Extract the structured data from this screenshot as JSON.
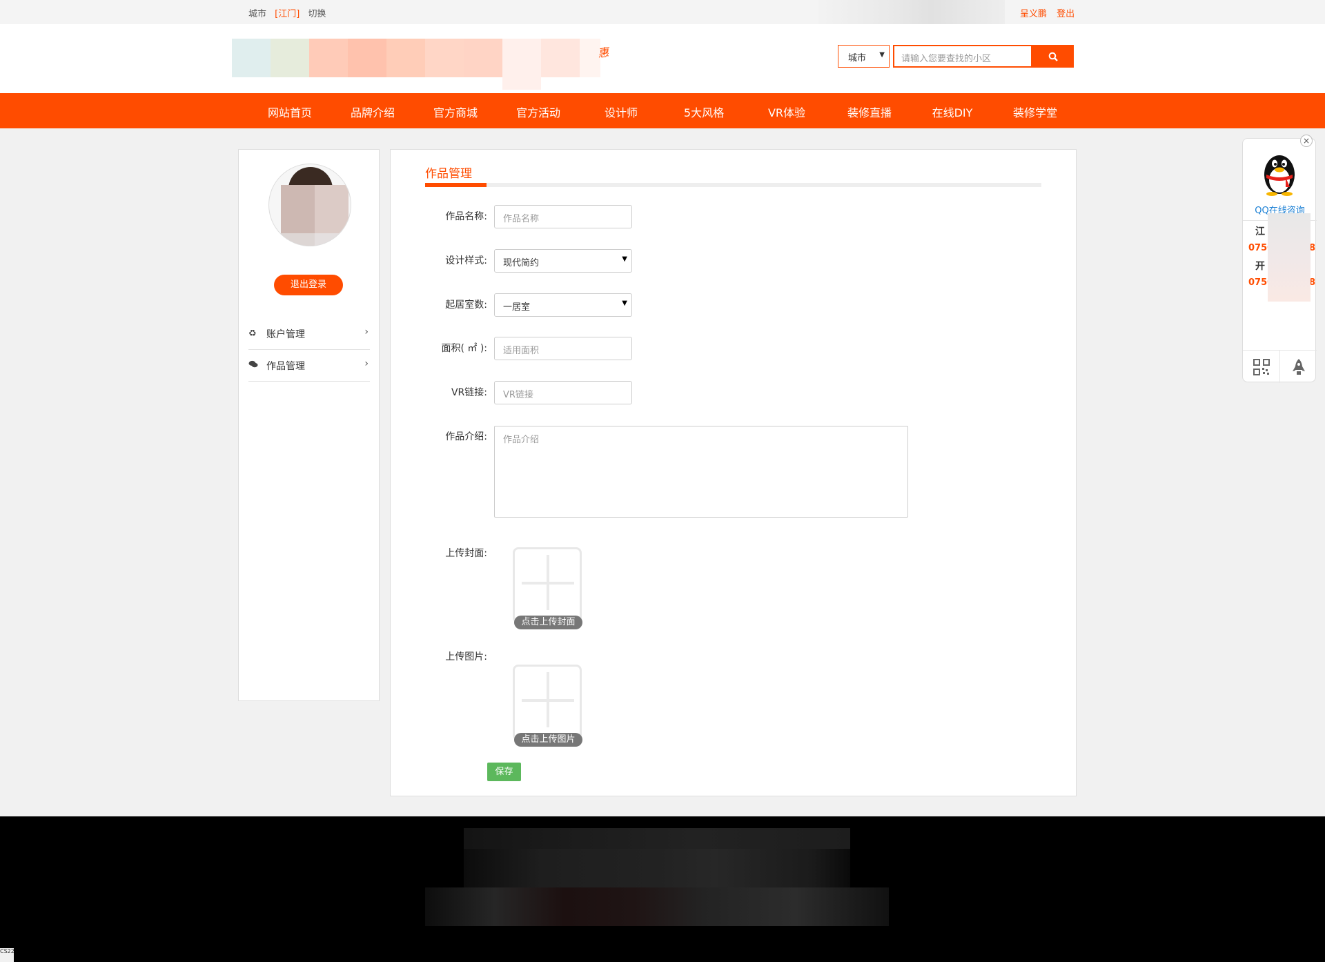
{
  "topbar": {
    "city_label": "城市",
    "city_value": "[江门]",
    "switch_label": "切换",
    "user_name": "呈义鹏",
    "logout_label": "登出"
  },
  "header": {
    "logo_tail": "惠",
    "city_select": "城市",
    "search_placeholder": "请输入您要查找的小区",
    "search_icon": "search-icon"
  },
  "nav": {
    "items": [
      "网站首页",
      "品牌介绍",
      "官方商城",
      "官方活动",
      "设计师",
      "5大风格",
      "VR体验",
      "装修直播",
      "在线DIY",
      "装修学堂"
    ]
  },
  "sidebar": {
    "logout_button": "退出登录",
    "menu": [
      {
        "label": "账户管理",
        "icon": "recycle-icon"
      },
      {
        "label": "作品管理",
        "icon": "comments-icon"
      }
    ]
  },
  "form": {
    "title": "作品管理",
    "fields": {
      "name_label": "作品名称:",
      "name_placeholder": "作品名称",
      "style_label": "设计样式:",
      "style_value": "现代简约",
      "rooms_label": "起居室数:",
      "rooms_value": "一居室",
      "area_label": "面积( ㎡ ):",
      "area_placeholder": "适用面积",
      "vr_label": "VR链接:",
      "vr_placeholder": "VR链接",
      "intro_label": "作品介绍:",
      "intro_placeholder": "作品介绍",
      "cover_label": "上传封面:",
      "cover_caption": "点击上传封面",
      "images_label": "上传图片:",
      "images_caption": "点击上传图片"
    },
    "save_button": "保存"
  },
  "qq_float": {
    "label": "QQ在线咨询",
    "city1": "江",
    "phone1": "0750",
    "phone1_tail": "8",
    "city2": "开",
    "phone2": "0750",
    "phone2_tail": "8"
  },
  "colors": {
    "brand": "#ff4c00",
    "save": "#5cb85c",
    "qq_label": "#1a7fd4"
  },
  "corner_text": "CS22"
}
